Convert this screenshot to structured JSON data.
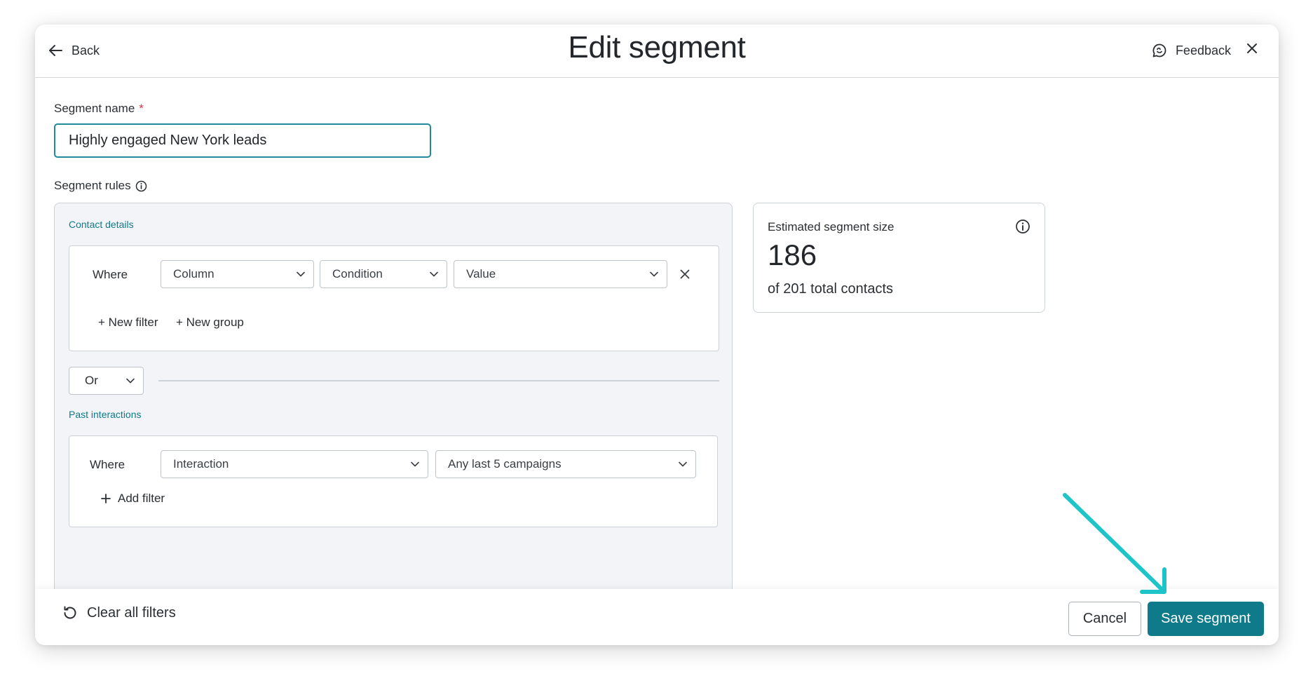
{
  "header": {
    "back_label": "Back",
    "title": "Edit segment",
    "feedback_label": "Feedback"
  },
  "segment_name": {
    "label": "Segment name",
    "required_mark": "*",
    "value": "Highly engaged New York leads"
  },
  "segment_rules": {
    "label": "Segment rules",
    "groups": [
      {
        "section_title": "Contact details",
        "where_label": "Where",
        "selects": [
          "Column",
          "Condition",
          "Value"
        ],
        "new_filter_label": "+ New filter",
        "new_group_label": "+ New group"
      },
      {
        "section_title": "Past interactions",
        "where_label": "Where",
        "selects": [
          "Interaction",
          "Any last 5 campaigns"
        ],
        "add_filter_label": "Add filter"
      }
    ],
    "operator": "Or"
  },
  "estimate": {
    "title": "Estimated segment size",
    "count": "186",
    "subtitle": "of 201 total contacts"
  },
  "footer": {
    "clear_label": "Clear all filters",
    "cancel_label": "Cancel",
    "save_label": "Save segment"
  },
  "colors": {
    "accent": "#0f7a8a",
    "annotation_arrow": "#1fc4c8",
    "required": "#d6334a"
  }
}
